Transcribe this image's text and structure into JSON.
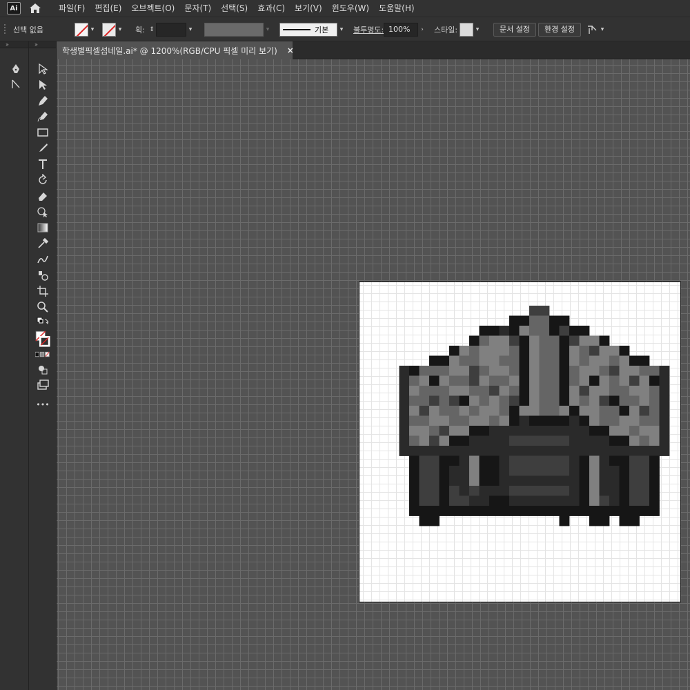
{
  "app": {
    "logo": "Ai"
  },
  "menu": [
    "파일(F)",
    "편집(E)",
    "오브젝트(O)",
    "문자(T)",
    "선택(S)",
    "효과(C)",
    "보기(V)",
    "윈도우(W)",
    "도움말(H)"
  ],
  "control": {
    "selection_status": "선택 없음",
    "stroke_weight_label": "획:",
    "stroke_profile": "기본",
    "opacity_label": "불투명도:",
    "opacity_value": "100%",
    "style_label": "스타일:",
    "doc_setup_button": "문서 설정",
    "preferences_button": "환경 설정"
  },
  "document": {
    "tab_title": "학생별픽셀섬네일.ai* @ 1200%(RGB/CPU 픽셀 미리 보기)",
    "close": "×"
  },
  "toolbar": {
    "more_label": "•••",
    "tools": [
      "selection-tool",
      "direct-selection-tool",
      "pen-tool",
      "curvature-tool",
      "rectangle-tool",
      "paintbrush-tool",
      "type-tool",
      "rotate-tool",
      "eraser-tool",
      "shape-builder-tool",
      "gradient-tool",
      "eyedropper-tool",
      "blend-tool",
      "symbol-sprayer-tool",
      "artboard-tool",
      "zoom-tool"
    ]
  },
  "colors": {
    "ui_dark": "#323232",
    "canvas_bg": "#535353",
    "pixel_palette": {
      "K": "#161616",
      "D": "#2a2a2a",
      "M": "#3e3e3e",
      "G": "#656565",
      "L": "#808080",
      "S": "#4d4d4d"
    }
  },
  "pixel_art": {
    "cell": 14.5,
    "rows": [
      "..............MM..............",
      "............KKGGKK............",
      ".........KKDKLGGKMKK..........",
      "........KGLLMKLGGKMLLK........",
      "......KLGLLLGKLGGKLGMLLK......",
      "....KKLGGLLGGKLGGKLGLLGLKK....",
      ".DKGGGLLMGLLGKLGGKGLLGMLLGGD..",
      ".DGLKLGGMLGGLKLGGKGLKLGLMLKD..",
      ".DLGGGLLGGMLGKLGGKLMLLGGLLGD..",
      ".DGGMGMKLGLGMKLGGKLGLMKGGLGD..",
      ".DLMLGGLGLLGKLLGGLKLLGGKLMGD..",
      ".DGGLLGGLLGLKDKKKKDKLGGLLGGD..",
      ".DLLGMLLKKDDDDDDDDDDKKLLGLLD..",
      ".DGLMLKKDDDDMMMMMMDDDDKKLGLD..",
      ".DDDDDDDDDDDDDDDDDDDDDDDDDDD..",
      "..KMMKKDLKKDMMMMMMDKLDKKMMK...",
      "..KMMKDDLKKDMMMMMMDKLDDKMMK...",
      "..KMMKDDLKKDDDDDDDDKLDDKMMK...",
      "..KMMKMDMDDDMMMMMMDKLDDKMMK...",
      "..KMMKMMDDKKDDDDDDDKLMDKMMK...",
      "..KKKKKKKKKKKKKKKKKKKKKKKKK...",
      "...KK............K..KK.KK....."
    ]
  }
}
